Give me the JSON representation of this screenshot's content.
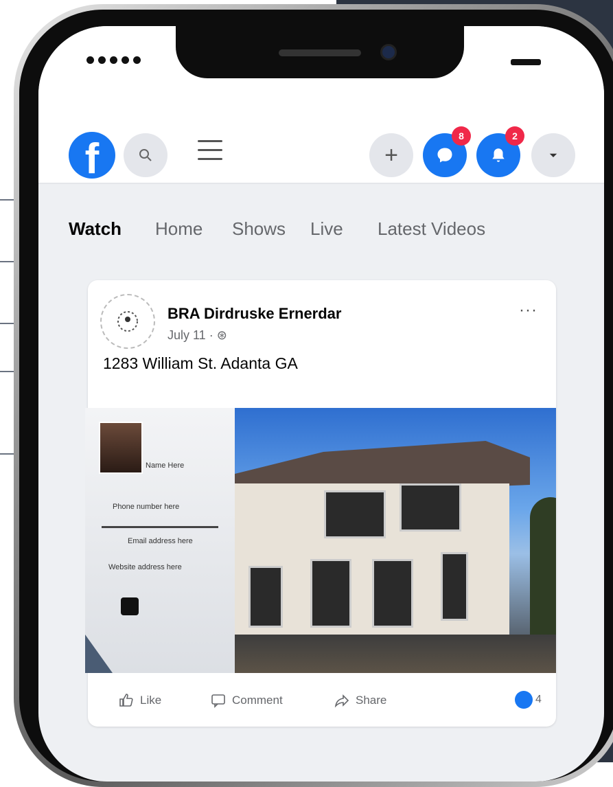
{
  "header": {
    "logo_letter": "f",
    "badges": {
      "messenger": "8",
      "notifications": "2"
    },
    "plus_label": "+"
  },
  "tabs": [
    "Watch",
    "Home",
    "Shows",
    "Live",
    "Latest Videos"
  ],
  "post": {
    "page_name": "BRA Dirdruske Ernerdar",
    "date": "July 11 · ⊛",
    "text": "1283 William St. Adanta GA",
    "more": "···",
    "flyer": {
      "agent_name": "Name Here",
      "lines": [
        "Phone number here",
        "Email address here",
        "Website address here"
      ]
    },
    "actions": {
      "like": "Like",
      "comment": "Comment",
      "share": "Share"
    },
    "reaction_count": "4"
  },
  "colors": {
    "brand": "#1877f2",
    "badge": "#f02849"
  }
}
